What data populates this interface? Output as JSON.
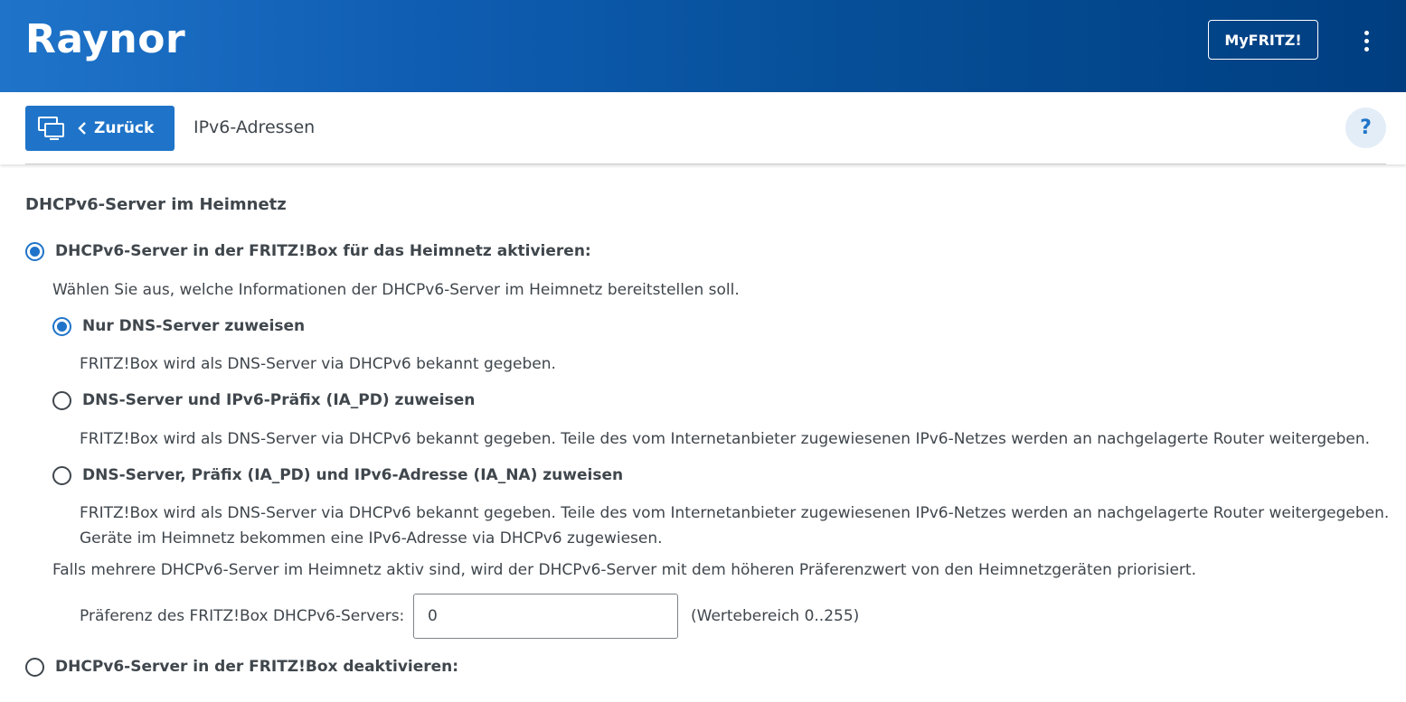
{
  "header": {
    "brand": "Raynor",
    "myfritz_label": "MyFRITZ!"
  },
  "nav": {
    "back_label": "Zurück",
    "page_title": "IPv6-Adressen",
    "help_label": "?"
  },
  "section": {
    "title": "DHCPv6-Server im Heimnetz",
    "enable_option": {
      "label": "DHCPv6-Server in der FRITZ!Box für das Heimnetz aktivieren:",
      "checked": true
    },
    "intro": "Wählen Sie aus, welche Informationen der DHCPv6-Server im Heimnetz bereitstellen soll.",
    "sub_options": [
      {
        "label": "Nur DNS-Server zuweisen",
        "checked": true,
        "desc": "FRITZ!Box wird als DNS-Server via DHCPv6 bekannt gegeben."
      },
      {
        "label": "DNS-Server und IPv6-Präfix (IA_PD) zuweisen",
        "checked": false,
        "desc": "FRITZ!Box wird als DNS-Server via DHCPv6 bekannt gegeben. Teile des vom Internetanbieter zugewiesenen IPv6-Netzes werden an nachgelagerte Router weitergeben."
      },
      {
        "label": "DNS-Server, Präfix (IA_PD) und IPv6-Adresse (IA_NA) zuweisen",
        "checked": false,
        "desc": "FRITZ!Box wird als DNS-Server via DHCPv6 bekannt gegeben. Teile des vom Internetanbieter zugewiesenen IPv6-Netzes werden an nachgelagerte Router weitergegeben.",
        "desc2": "Geräte im Heimnetz bekommen eine IPv6-Adresse via DHCPv6 zugewiesen."
      }
    ],
    "priority_note": "Falls mehrere DHCPv6-Server im Heimnetz aktiv sind, wird der DHCPv6-Server mit dem höheren Präferenzwert von den Heimnetzgeräten priorisiert.",
    "preference": {
      "label": "Präferenz des FRITZ!Box DHCPv6-Servers:",
      "value": "0",
      "range": "(Wertebereich 0..255)"
    },
    "disable_option": {
      "label": "DHCPv6-Server in der FRITZ!Box deaktivieren:",
      "checked": false
    }
  },
  "colors": {
    "accent": "#1f74c9",
    "header_dark": "#003e80",
    "text": "#3f464c"
  },
  "icons": [
    "monitor-icon",
    "chevron-left-icon",
    "kebab-menu-icon",
    "help-icon"
  ]
}
